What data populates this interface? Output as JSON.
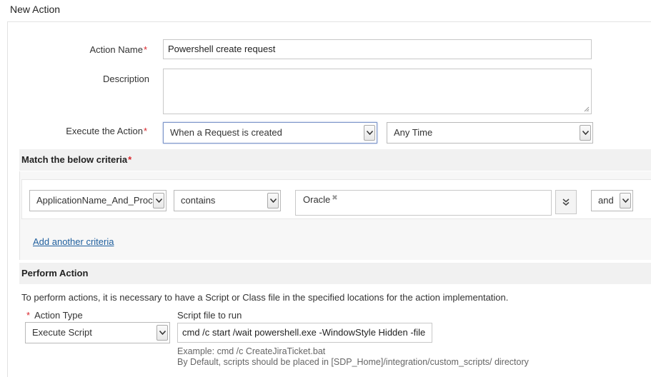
{
  "page": {
    "title": "New Action"
  },
  "form": {
    "action_name": {
      "label": "Action Name",
      "required_mark": "*",
      "value": "Powershell create request"
    },
    "description": {
      "label": "Description",
      "value": ""
    },
    "execute": {
      "label": "Execute the Action",
      "required_mark": "*",
      "trigger_selected": "When a Request is created",
      "time_selected": "Any Time"
    }
  },
  "criteria": {
    "heading": "Match the below criteria",
    "required_mark": "*",
    "rows": [
      {
        "field": "ApplicationName_And_Proc",
        "operator": "contains",
        "values": [
          "Oracle"
        ],
        "conjunction": "and"
      }
    ],
    "add_link": "Add another criteria"
  },
  "perform": {
    "heading": "Perform Action",
    "info": "To perform actions, it is necessary to have a Script or Class file in the specified locations for the action implementation.",
    "action_type": {
      "label": "Action Type",
      "required_mark": "*",
      "selected": "Execute Script"
    },
    "script": {
      "label": "Script file to run",
      "value": "cmd /c start /wait powershell.exe -WindowStyle Hidden -file",
      "example": "Example: cmd /c CreateJiraTicket.bat",
      "default_note": "By Default, scripts should be placed in [SDP_Home]/integration/custom_scripts/ directory"
    }
  },
  "icons": {
    "dropdown": "chevron-down-icon",
    "expand": "double-chevron-down-icon",
    "remove": "close-icon"
  },
  "colors": {
    "required": "#d9262c",
    "link": "#1f5f9e",
    "section_bg": "#f1f1f1"
  }
}
